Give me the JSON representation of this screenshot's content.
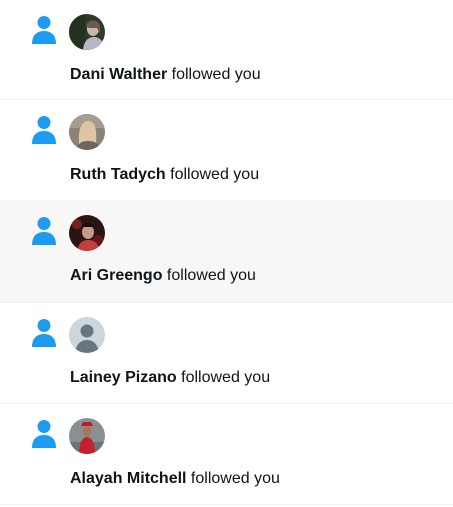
{
  "colors": {
    "accent": "#1d9bf0",
    "text": "#0f1419",
    "divider": "#eff3f4",
    "highlight_bg": "#f7f7f7"
  },
  "notifications": [
    {
      "user_name": "Dani Walther",
      "action": " followed you",
      "icon": "person-icon",
      "avatar": "photo"
    },
    {
      "user_name": "Ruth Tadych",
      "action": " followed you",
      "icon": "person-icon",
      "avatar": "photo"
    },
    {
      "user_name": "Ari Greengo",
      "action": " followed you",
      "icon": "person-icon",
      "avatar": "photo",
      "highlighted": true
    },
    {
      "user_name": "Lainey Pizano",
      "action": " followed you",
      "icon": "person-icon",
      "avatar": "default-profile"
    },
    {
      "user_name": "Alayah Mitchell",
      "action": " followed you",
      "icon": "person-icon",
      "avatar": "photo"
    }
  ]
}
